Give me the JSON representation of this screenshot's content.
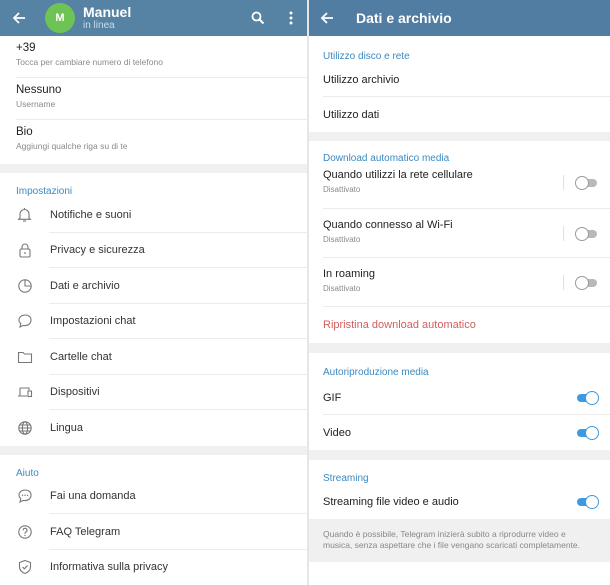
{
  "left": {
    "header": {
      "avatar_initial": "M",
      "name": "Manuel",
      "status": "in linea",
      "icons": [
        "back-arrow-icon",
        "search-icon",
        "more-vertical-icon"
      ]
    },
    "info": [
      {
        "main": "+39",
        "sub": "Tocca per cambiare numero di telefono"
      },
      {
        "main": "Nessuno",
        "sub": "Username"
      },
      {
        "main": "Bio",
        "sub": "Aggiungi qualche riga su di te"
      }
    ],
    "settings": {
      "header": "Impostazioni",
      "items": [
        {
          "label": "Notifiche e suoni",
          "icon": "bell-icon"
        },
        {
          "label": "Privacy e sicurezza",
          "icon": "lock-icon"
        },
        {
          "label": "Dati e archivio",
          "icon": "pie-chart-icon"
        },
        {
          "label": "Impostazioni chat",
          "icon": "chat-bubble-icon"
        },
        {
          "label": "Cartelle chat",
          "icon": "folder-icon"
        },
        {
          "label": "Dispositivi",
          "icon": "devices-icon"
        },
        {
          "label": "Lingua",
          "icon": "globe-icon"
        }
      ]
    },
    "help": {
      "header": "Aiuto",
      "items": [
        {
          "label": "Fai una domanda",
          "icon": "chat-dots-icon"
        },
        {
          "label": "FAQ Telegram",
          "icon": "question-circle-icon"
        },
        {
          "label": "Informativa sulla privacy",
          "icon": "shield-check-icon"
        }
      ]
    }
  },
  "right": {
    "header": {
      "title": "Dati e archivio",
      "icon": "back-arrow-icon"
    },
    "disk": {
      "header": "Utilizzo disco e rete",
      "items": [
        "Utilizzo archivio",
        "Utilizzo dati"
      ]
    },
    "autodownload": {
      "header": "Download automatico media",
      "items": [
        {
          "label": "Quando utilizzi la rete cellulare",
          "sub": "Disattivato",
          "enabled": false
        },
        {
          "label": "Quando connesso al Wi-Fi",
          "sub": "Disattivato",
          "enabled": false
        },
        {
          "label": "In roaming",
          "sub": "Disattivato",
          "enabled": false
        }
      ],
      "reset_label": "Ripristina download automatico"
    },
    "autoplay": {
      "header": "Autoriproduzione media",
      "items": [
        {
          "label": "GIF",
          "enabled": true
        },
        {
          "label": "Video",
          "enabled": true
        }
      ]
    },
    "streaming": {
      "header": "Streaming",
      "item": {
        "label": "Streaming file video e audio",
        "enabled": true
      },
      "note": "Quando è possibile, Telegram inizierà subito a riprodurre video e musica, senza aspettare che i file vengano scaricati completamente."
    }
  },
  "colors": {
    "appbar": "#5682a3",
    "avatar": "#6dc454",
    "section_header": "#3a8ac2",
    "toggle_on": "#3d9ae0",
    "reset_red": "#d25e5e"
  }
}
